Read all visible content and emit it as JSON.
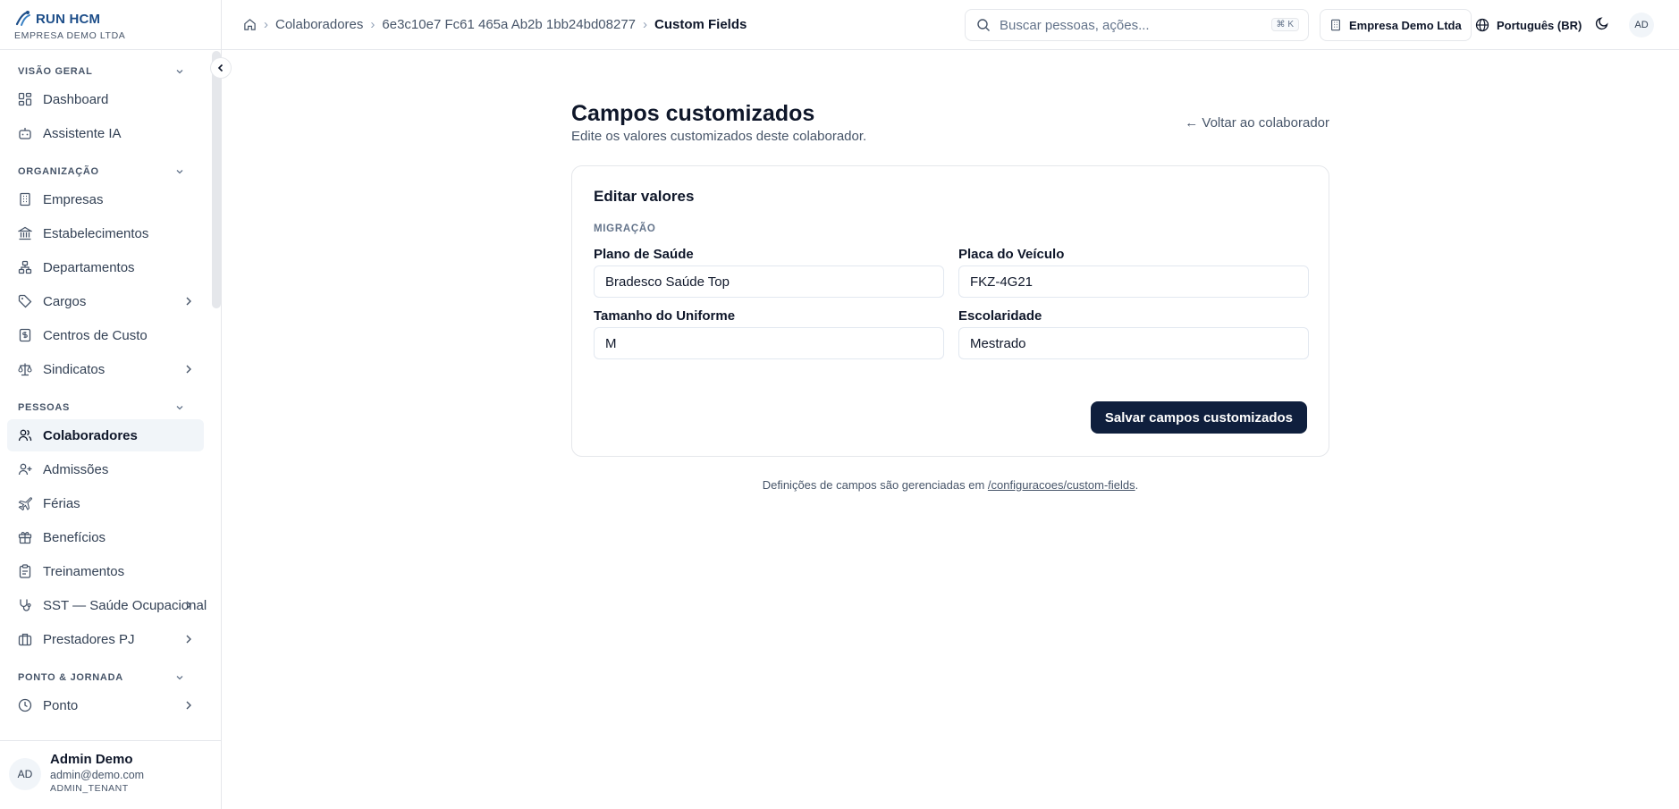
{
  "brand": {
    "name": "RUN HCM",
    "company": "EMPRESA DEMO LTDA"
  },
  "sidebar": {
    "sections": [
      {
        "label": "VISÃO GERAL",
        "items": [
          {
            "label": "Dashboard",
            "icon": "dashboard-icon"
          },
          {
            "label": "Assistente IA",
            "icon": "bot-icon"
          }
        ]
      },
      {
        "label": "ORGANIZAÇÃO",
        "items": [
          {
            "label": "Empresas",
            "icon": "building-icon"
          },
          {
            "label": "Estabelecimentos",
            "icon": "landmark-icon"
          },
          {
            "label": "Departamentos",
            "icon": "network-icon"
          },
          {
            "label": "Cargos",
            "icon": "tag-icon",
            "expandable": true
          },
          {
            "label": "Centros de Custo",
            "icon": "receipt-icon"
          },
          {
            "label": "Sindicatos",
            "icon": "scale-icon",
            "expandable": true
          }
        ]
      },
      {
        "label": "PESSOAS",
        "items": [
          {
            "label": "Colaboradores",
            "icon": "users-icon",
            "active": true
          },
          {
            "label": "Admissões",
            "icon": "user-plus-icon"
          },
          {
            "label": "Férias",
            "icon": "plane-icon"
          },
          {
            "label": "Benefícios",
            "icon": "gift-icon"
          },
          {
            "label": "Treinamentos",
            "icon": "clipboard-icon"
          },
          {
            "label": "SST — Saúde Ocupacional",
            "icon": "stethoscope-icon",
            "expandable": true
          },
          {
            "label": "Prestadores PJ",
            "icon": "briefcase-icon",
            "expandable": true
          }
        ]
      },
      {
        "label": "PONTO & JORNADA",
        "items": [
          {
            "label": "Ponto",
            "icon": "clock-icon",
            "expandable": true
          }
        ]
      }
    ]
  },
  "user": {
    "initials": "AD",
    "name": "Admin Demo",
    "email": "admin@demo.com",
    "role": "ADMIN_TENANT"
  },
  "header": {
    "breadcrumbs": [
      "Colaboradores",
      "6e3c10e7 Fc61 465a Ab2b 1bb24bd08277",
      "Custom Fields"
    ],
    "search_placeholder": "Buscar pessoas, ações...",
    "search_shortcut": "⌘ K",
    "company": "Empresa Demo Ltda",
    "language": "Português (BR)",
    "avatar": "AD"
  },
  "page": {
    "title": "Campos customizados",
    "subtitle": "Edite os valores customizados deste colaborador.",
    "back_link": "← Voltar ao colaborador",
    "card_title": "Editar valores",
    "group_label": "MIGRAÇÃO",
    "fields": [
      {
        "label": "Plano de Saúde",
        "value": "Bradesco Saúde Top"
      },
      {
        "label": "Placa do Veículo",
        "value": "FKZ-4G21"
      },
      {
        "label": "Tamanho do Uniforme",
        "value": "M"
      },
      {
        "label": "Escolaridade",
        "value": "Mestrado"
      }
    ],
    "save_label": "Salvar campos customizados",
    "footnote_prefix": "Definições de campos são gerenciadas em ",
    "footnote_link": "/configuracoes/custom-fields",
    "footnote_suffix": "."
  }
}
